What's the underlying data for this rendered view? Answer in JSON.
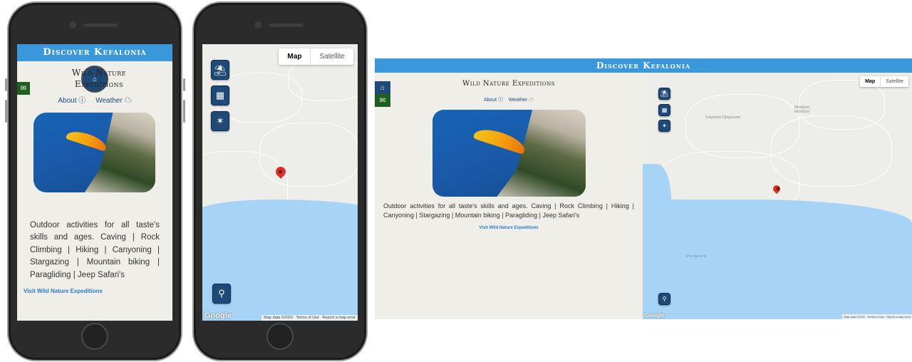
{
  "site": {
    "brand": "Discover Kefalonia",
    "page_title": "Wild Nature Expeditions",
    "nav": {
      "about": "About",
      "weather": "Weather"
    },
    "description": "Outdoor activities for all taste's skills and ages. Caving | Rock Climbing | Hiking | Canyoning | Stargazing | Mountain biking | Paragliding | Jeep Safari's",
    "visit_link": "Visit Wild Nature Expeditions"
  },
  "map": {
    "type_map": "Map",
    "type_satellite": "Satellite",
    "google": "Google",
    "map_data": "Map data ©2020",
    "terms": "Terms of Use",
    "report": "Report a map error",
    "place_labels": {
      "village": "Σvόρπατα Σβορώνατα",
      "village2": "Μετάξατα Μετάξατα",
      "bay": "ΑΓΙΑ ΠΕΛΑΓΙΑ"
    }
  },
  "icons": {
    "home": "home-icon",
    "mail": "envelope-icon",
    "info": "info-icon",
    "weather": "cloud-sun-icon",
    "beach": "beach-umbrella-icon",
    "hotel": "building-icon",
    "hiking": "hiker-icon",
    "zoom": "magnifier-icon"
  },
  "colors": {
    "header": "#3a97d9",
    "nav_dark": "#1f4a78",
    "mail_green": "#1e5e1f",
    "link": "#2a7bd1",
    "sea": "#a7d3f7",
    "page_bg": "#efeee9"
  }
}
